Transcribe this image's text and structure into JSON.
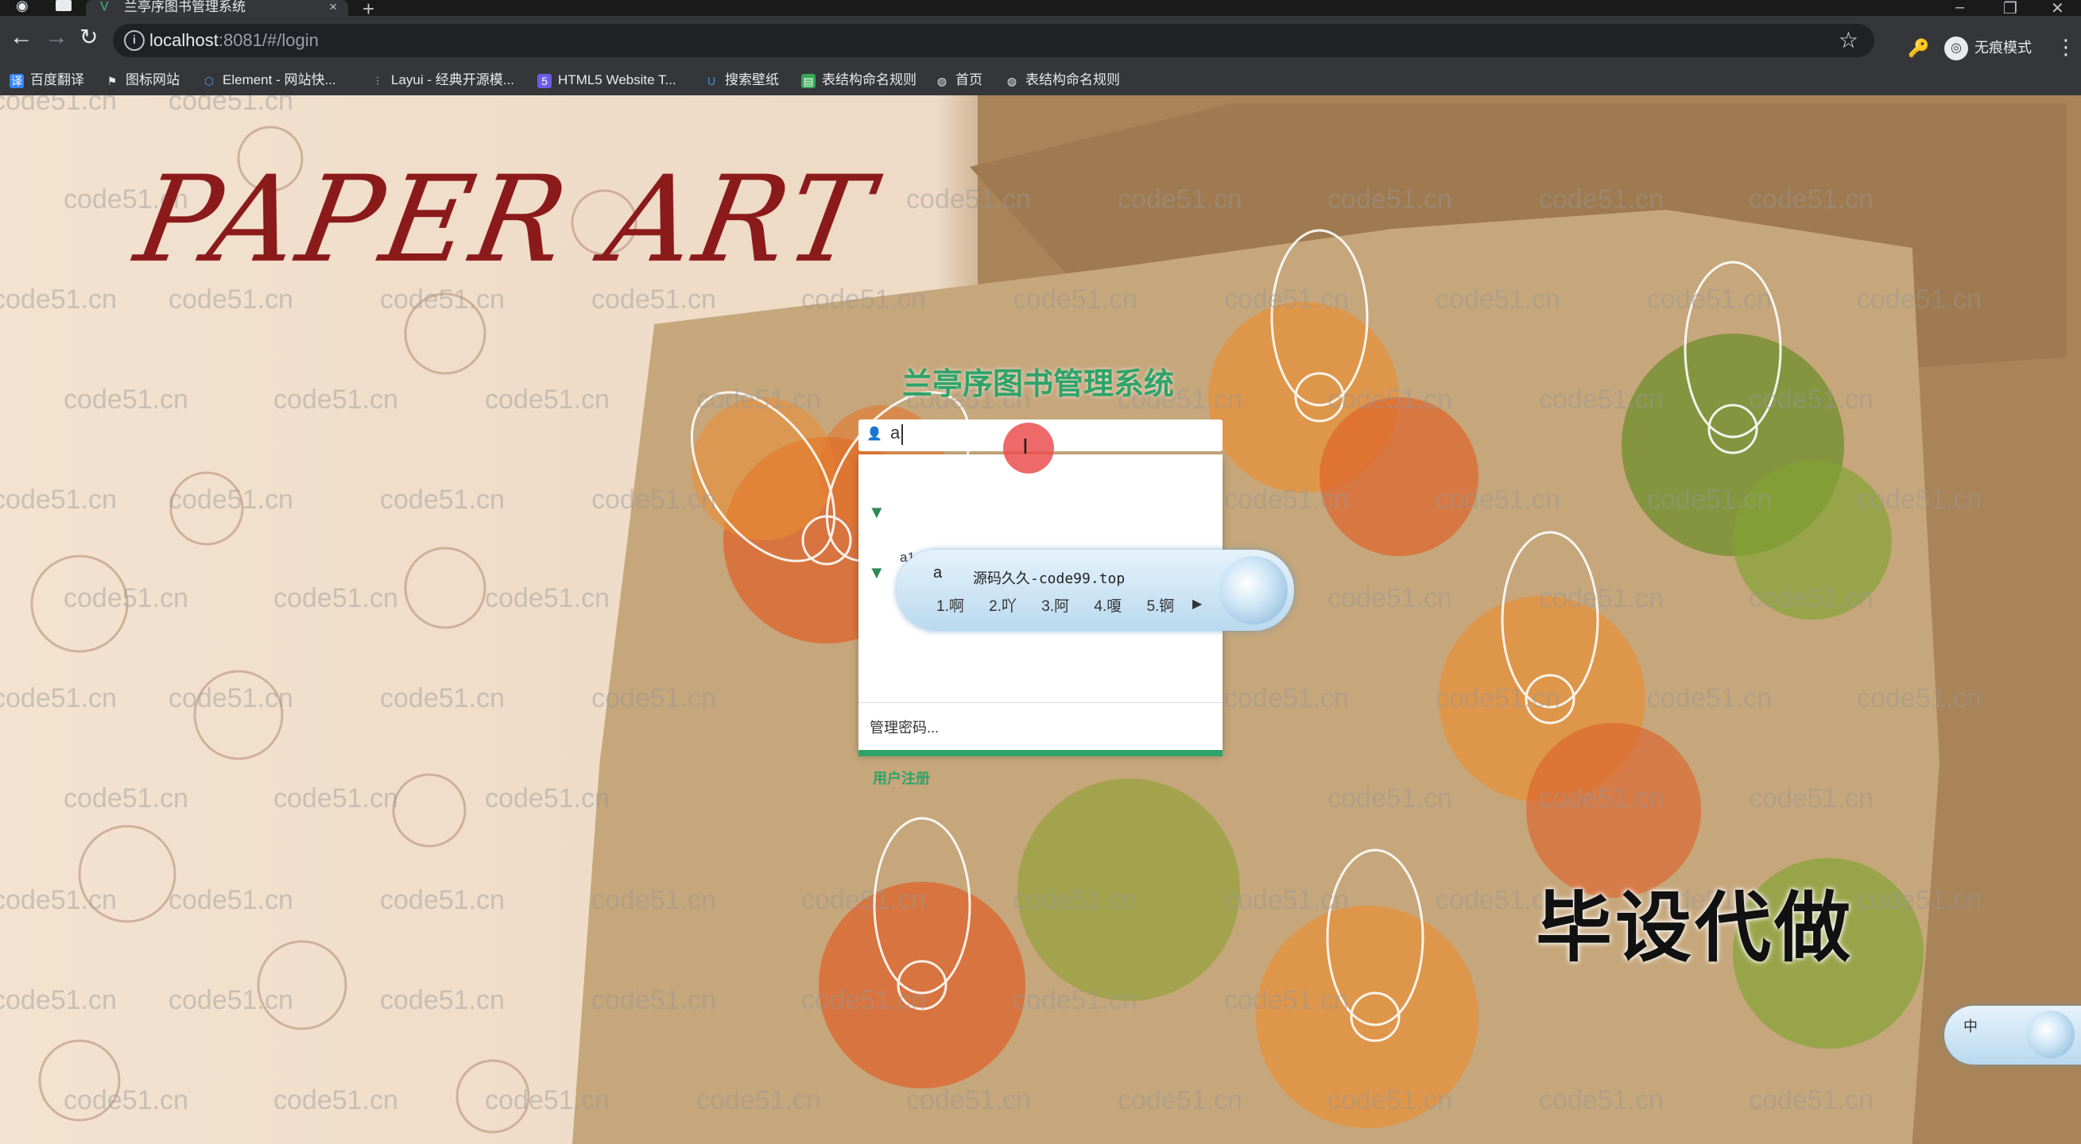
{
  "browser": {
    "tab_title": "兰亭序图书管理系统",
    "tab_close": "×",
    "new_tab": "+",
    "url": "localhost:8081/#/login",
    "url_host": "localhost",
    "url_rest": ":8081/#/login",
    "profile_label": "无痕模式",
    "window_controls": [
      "–",
      "❐",
      "✕"
    ]
  },
  "bookmarks": [
    {
      "label": "百度翻译",
      "icon": "translate-icon",
      "color": "#3385ff"
    },
    {
      "label": "图标网站",
      "icon": "flag-icon",
      "color": "#ffffff"
    },
    {
      "label": "Element - 网站快...",
      "icon": "element-icon",
      "color": "#409eff"
    },
    {
      "label": "Layui - 经典开源模...",
      "icon": "layui-icon",
      "color": "#e8eaed"
    },
    {
      "label": "HTML5 Website T...",
      "icon": "html5-icon",
      "color": "#6c5ce7"
    },
    {
      "label": "搜索壁纸",
      "icon": "wallpaper-icon",
      "color": "#4a90e2"
    },
    {
      "label": "表结构命名规则",
      "icon": "doc-icon",
      "color": "#34a853"
    },
    {
      "label": "首页",
      "icon": "globe-icon",
      "color": "#e8eaed"
    },
    {
      "label": "表结构命名规则",
      "icon": "globe-icon",
      "color": "#e8eaed"
    }
  ],
  "page": {
    "hero_title": "PAPER ART",
    "system_title": "兰亭序图书管理系统",
    "username_value": "a",
    "register_link": "用户注册",
    "overlay_text": "毕设代做",
    "watermark": "code51.cn"
  },
  "autofill": {
    "items": [
      {
        "username": "",
        "password": ""
      },
      {
        "username": "a1",
        "password": "••••••"
      }
    ],
    "manage": "管理密码..."
  },
  "ime": {
    "composition": "a",
    "header": "源码久久-code99.top",
    "candidates": [
      "1.啊",
      "2.吖",
      "3.阿",
      "4.嗄",
      "5.锕"
    ],
    "mini_label": "中"
  },
  "colors": {
    "accent": "#2ea36a",
    "title_red": "#8b1a1a"
  }
}
